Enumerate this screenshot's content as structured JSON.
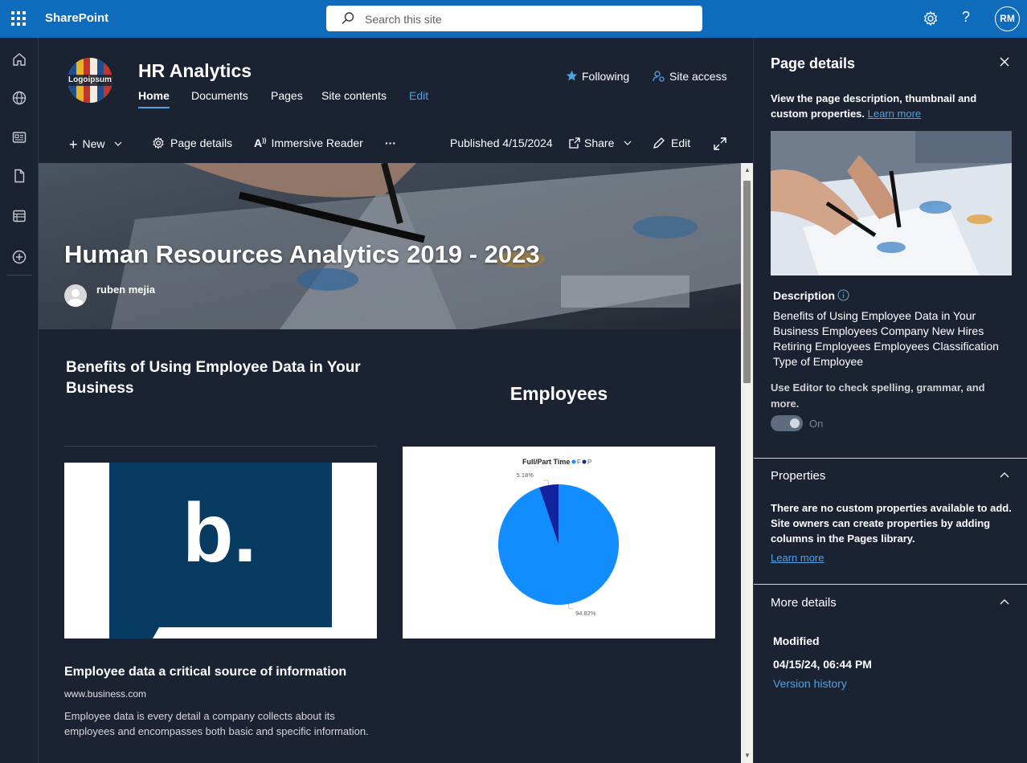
{
  "suite": {
    "brand": "SharePoint",
    "search_placeholder": "Search this site",
    "user_initials": "RM"
  },
  "site": {
    "logo_text": "Logoipsum",
    "title": "HR Analytics",
    "nav": [
      {
        "label": "Home",
        "active": true
      },
      {
        "label": "Documents"
      },
      {
        "label": "Pages"
      },
      {
        "label": "Site contents"
      },
      {
        "label": "Edit"
      }
    ],
    "following_label": "Following",
    "site_access_label": "Site access"
  },
  "command_bar": {
    "new_label": "New",
    "page_details_label": "Page details",
    "immersive_reader_label": "Immersive Reader",
    "more_label": "···",
    "published_label": "Published 4/15/2024",
    "share_label": "Share",
    "edit_label": "Edit"
  },
  "hero": {
    "title": "Human Resources Analytics 2019 - 2023",
    "author": "ruben mejia"
  },
  "section_left": {
    "title": "Benefits of Using Employee Data in Your Business",
    "image_letter": "b."
  },
  "section_right": {
    "title": "Employees"
  },
  "chart_data": {
    "type": "pie",
    "title": "Full/Part Time",
    "legend": [
      {
        "label": "F",
        "color": "#118dff"
      },
      {
        "label": "P",
        "color": "#12239e"
      }
    ],
    "slices": [
      {
        "label": "F",
        "value": 94.82,
        "display": "94.82%",
        "color": "#118dff"
      },
      {
        "label": "P",
        "value": 5.18,
        "display": "5.18%",
        "color": "#12239e"
      }
    ]
  },
  "card": {
    "title": "Employee data a critical source of information",
    "url": "www.business.com",
    "description": "Employee data is every detail a company collects about its employees and encompasses both basic and specific information."
  },
  "panel": {
    "title": "Page details",
    "intro": "View the page description, thumbnail and custom properties.",
    "intro_link": "Learn more",
    "description_label": "Description",
    "description": "Benefits of Using Employee Data in Your Business Employees Company New Hires Retiring Employees Employees Classification Type of Employee",
    "editor_note": "Use Editor to check spelling, grammar, and more.",
    "toggle_label": "On",
    "properties_title": "Properties",
    "properties_text": "There are no custom properties available to add. Site owners can create properties by adding columns in the Pages library.",
    "properties_link": "Learn more",
    "more_details_title": "More details",
    "modified_label": "Modified",
    "modified_value": "04/15/24, 06:44 PM",
    "version_history": "Version history"
  },
  "colors": {
    "suite_blue": "#0f6cbd",
    "background": "#1b2333",
    "link": "#4fa3e0",
    "pie_primary": "#118dff",
    "pie_secondary": "#12239e"
  }
}
